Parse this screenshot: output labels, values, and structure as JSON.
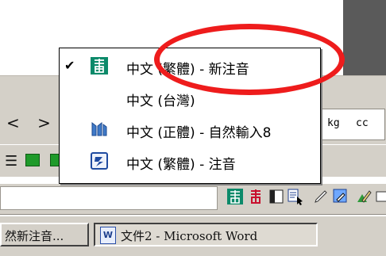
{
  "background": {
    "nav_arrows": "< >",
    "units": {
      "kg": "kg",
      "cc": "cc"
    }
  },
  "menu": {
    "items": [
      {
        "label": "中文 (繁體) - 新注音",
        "checked": true,
        "icon": "new-phonetic-ime-icon"
      },
      {
        "label": "中文 (台灣)",
        "checked": false,
        "icon": ""
      },
      {
        "label": "中文 (正體) - 自然輸入8",
        "checked": false,
        "icon": "natural-input-ime-icon"
      },
      {
        "label": "中文 (繁體) - 注音",
        "checked": false,
        "icon": "phonetic-ime-icon"
      }
    ],
    "check_glyph": "✔"
  },
  "taskbar": {
    "items": [
      {
        "label": "然新注音..."
      },
      {
        "label": "文件2 - Microsoft Word"
      }
    ]
  },
  "colors": {
    "annotation": "#ee1c1c",
    "ime_green": "#0c8a6a",
    "ime_red": "#c8102e"
  }
}
